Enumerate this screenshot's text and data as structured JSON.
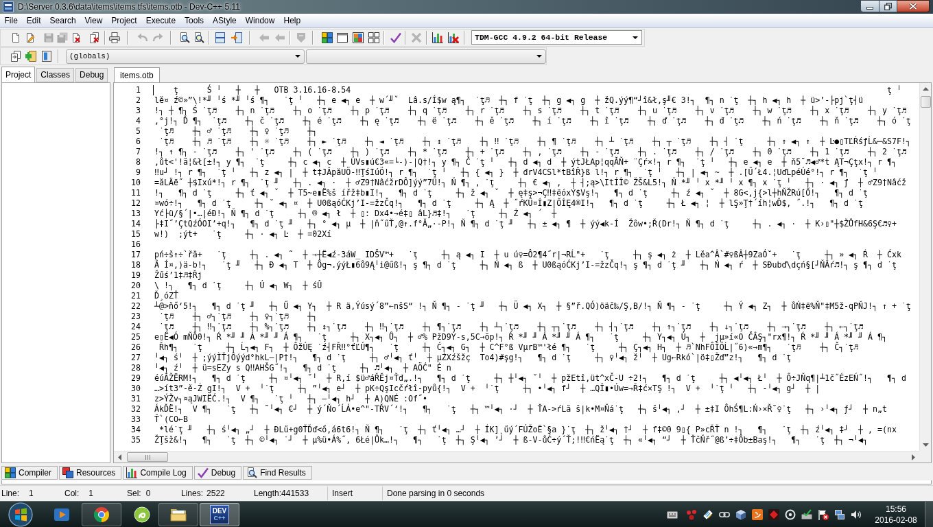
{
  "window": {
    "title": "D:\\Server 0.3.6\\data\\items\\items tfs\\items.otb - Dev-C++ 5.11"
  },
  "menu": [
    "File",
    "Edit",
    "Search",
    "View",
    "Project",
    "Execute",
    "Tools",
    "AStyle",
    "Window",
    "Help"
  ],
  "toolbar": {
    "compiler": "TDM-GCC 4.9.2 64-bit Release",
    "scope": "(globals)"
  },
  "left_panel": {
    "tabs": [
      {
        "label": "Project",
        "selected": true
      },
      {
        "label": "Classes",
        "selected": false
      },
      {
        "label": "Debug",
        "selected": false
      }
    ]
  },
  "editor": {
    "tabs": [
      {
        "label": "items.otb",
        "selected": true
      }
    ],
    "lines": [
      {
        "number": "1",
        "text": "    ţ      Ś ╵   ┼   ┼   OTB 3.16.16-8.54                                                                                                                ţ ╵"
      },
      {
        "number": "2",
        "text": "lĕ¤ ź©»”\\!*╜ ╵ś *╜ ╵ś ¶┐   ˙ţ ╵   ┼┐ e ◀┐ e  ┼ w´╜ˇ  Lâ.s/Í$w ą¶┐  ˙ţ♬  ┼┐ f ˙ţ  ┼┐ g ◀┐ g  ┼ žQ.ýý¶“┘î&ł,ş╜€ 3!┐  ¶┐ n ˙ţ  ┼┐ h ◀┐ h  ┼ ü>’-├pj`ţ┤ü"
      },
      {
        "number": "3",
        "text": "!┐ ┼ ¶┐ Ś ˙ţ♬    ┼┐ n ˙ţ♬    ┼┐ o ˙ţ♬    ┼┐ p ˙ţ♬    ┼┐ q ˙ţ♬    ┼┐ r ˙ţ♬    ┼┐ s ˙ţ♬    ┼┐ t ˙ţ♬    ┼┐ u ˙ţ♬    ┼┐ v ˙ţ♬    ┼┐ w ˙ţ♬    ┼┐ x ˙ţ♬    ┼┐ y ˙ţ♬"
      },
      {
        "number": "4",
        "text": ",°j!┐ Ď ¶┐  ˙ţ♬    ┼┐ č ˙ţ♬    ┼┐ é ˙ţ♬    ┼┐ ę ˙ţ♬    ┼┐ ë ˙ţ♬    ┼┐ ě ˙ţ♬    ┼┐ í ˙ţ♬    ┼┐ î ˙ţ♬    ┼┐ ď ˙ţ♬    ┼┐ đ ˙ţ♬    ┼┐ ń ˙ţ♬    ┼┐ ň ˙ţ♬    ┼┐ ó ˙ţ"
      },
      {
        "number": "5",
        "text": " ˙ţ♬    ┼┐ ♂ ˙ţ♬    ┼┐ ♀ ˙ţ♬    ┼┐"
      },
      {
        "number": "6",
        "text": " ˙ţ♬    ┼┐ ♬ ˙ţ♬    ┼┐ ☼ ˙ţ♬    ┼┐ ► ˙ţ♬    ┼┐ ◄ ˙ţ♬    ┼┐ ↕ ˙ţ♬    ┼┐ ‼ ˙ţ♬    ┼┐ ¶ ˙ţ♬    ┼┐ ┴ ˙ţ♬    ┼┐ ┬ ˙ţ♬    ┼┐ ┤ ˙ţ     ┼┐ ↑ ◀┐ ↑  ┼ Ŀ●▯TĽŔśƒĹ&─&S7F!┐"
      },
      {
        "number": "7",
        "text": "!┐ ↑ ¶┐ - ˙ţ♬    ┼┐ ' ˙ţ♬    ┼┐ ( ˙ţ♬    ┼┐ ) ˙ţ♬    ┼┐ * ˙ţ♬    ┼┐ + ˙ţ♬    ┼┐ , ˙ţ♬    ┼┐ - ˙ţ♬    ┼┐ . ˙ţ♬    ┼┐ / ˙ţ♬    ┼┐ 0 ˙ţ♬    ┼┐ 1 ˙ţ♬    ┼┐ 2 ˙ţ♬"
      },
      {
        "number": "8",
        "text": ",ůt<'!ă¦&ł[±!┐ y ¶┐  ˙ţ     ┼┐ c ◀┐ c  ┼ ÚVs▮ú€3«=└-)-|Q†!┐ y ¶┐ Č ˙ţ ╵   ┼┐ d ◀┐ d  ┼ ýtJŁAp¦qqĂŇ+ ¨Çŕ×!┐ r ¶┐  ˙ţ ╵   ┼┐ e ◀┐ e  ┼ ň5˘♬◀♂*t ĄT¬Çţx!┐ r ¶┐"
      },
      {
        "number": "9",
        "text": "‼u┘ !┐ r ¶┐  ˙ţ ╵   ┼┐ z ◀┐ |  ┼ t‡JÂpăUÖ-‼ŢśIúÖ!┐ r ¶┐  ˙ţ ╵   ┼┐ { ◀┐ }  ┼ đrV4CSl*tBîŘ}ß l!┐ r ¶┐  ˙ţ ╵   ┼┐ | ◀┐ ~  ┼ .[Ű´Ł4.¦UďLpéÚé°!┐ r ¶┐  ˙ţ ╵"
      },
      {
        "number": "10",
        "text": "=ăLÄë˝ ┼$Ixú*!┐ r ¶┐  ˙ţ ╜   ┼┐ . ◀┐ ·  ┼ ♂Z9†NâćžrDÔ]ýý”7Ű!┐ Ň ¶┐ , ˙ţ     ┼┐ € ◀┐ ,  ┼ ┤;ą>\\ItÍÎ© ŽŠ&L5!┐ Ň *╜ ╵ x *╜ ╵ x ¶┐ x ˙ţ ╵   ┼┐ · ◀┐ ƒ  ┼ ♂Z9†Nâćž"
      },
      {
        "number": "11",
        "text": "!┐   ¶┐ d ˙ţ     ┼┐ ť ◀┐ ˇ  ┼ T5~e▮Ë%š ířž‡b▮I!┐   ¶┐ d ˙ţ     ┼┐ ž ◀┐ ˇ  ┼ ę‡ş>¬Ç‼‡ëóxÝ$Vş!┐   ¶┐ d ˙ţ     ┼┐ ź ◀┐ ˇ  ┼ 8G<,j{>l┼hŇŽRú[Ő!┐   ¶┐ d ˙ţ"
      },
      {
        "number": "12",
        "text": "¤wó÷!┐   ¶┐ d ˙ţ     ┼┐ ˘ ◀┐ ¤  ┼ U0ßąóĆKj’I-=žzČq!┐   ¶┐ d ˙ţ     ┼┐ Ą  ┼ ˝ŕKŰ¤Í▮Z|ŐÍĘ4®I!┐   ¶┐ d ˙ţ     ┼┐ Ł ◀┐ ¦  ┼ lŞ»Ţ†´íh¦wĎ$, ˝.!┐   ¶┐ d ˙ţ"
      },
      {
        "number": "13",
        "text": "Yć├ü/§´|•…|éĐ!┐ Ň ¶┐ d ˙ţ     ┼┐ ® ◀┐ ł  ┼ ▯: Dx4•→é‡▯ âL}♬‡!┐   ˙ţ     ┼┐ Ż ◀┐ ´  ┼"
      },
      {
        "number": "14",
        "text": "├‡I˝’ÇtQźÓOI’+q!┐   ¶┐ d ˙ţ ╜   ┼┐ ° ◀┐ µ  ┼ |ň˝űŤ,@↑.f°Ă„·-P!┐ Ň ¶┐ d ˙ţ ╜   ┼┐ ± ◀┐ ¶  ┼ ýý◀k-Í  Žôw•;Ř(Dr!┐ Ň ¶┐ d ˙ţ     ┼┐ . ◀┐ ·  ┼ K›▯\"┼$ŽŮfH&6Ş€♬♀+"
      },
      {
        "number": "15",
        "text": "w!)  ;ýt+   ˙ţ     ┼┐ · ◀┐ Ŀ  ┼ =02Xí"
      },
      {
        "number": "16"
      },
      {
        "number": "17",
        "text": "pń÷š↑÷`řă+   ˙ţ     ┼┐ . ◀┐ ˜  ┼ →┼Ë◀ź-3áW_ IDŠV™+   ˙ţ     ┼┐ ą ◀┐ I  ┼ u ú♀=Ô2¶4˝r|¬RĹ\"+   ˙ţ     ┼┐ ş ◀┐ ż  ┼ Lĕa^Â`#♀ßÂ┼9ZaÓ˘+   ˙ţ     ┼┐ » ◀┐ Ŕ  ┼ Ćxk"
      },
      {
        "number": "18",
        "text": "Â Í¤,)ä-b!┐   ˙ţ ╜   ┼┐ Đ ◀┐ T  ┼ Ôg¬.ýýŁ▮6ů9Ą╵i@űß!┐ ş ¶┐ d ˙ţ     ┼┐ Ń ◀┐ ß  ┼ U0ßąóĆKj’I-=žzČq!┐ ş ¶┐ d ˙ţ ╜   ┼┐ Ń ◀┐ ŕ  ┼ SĐubď\\dçń§[┘ŇÂŕ♬!┐ ş ¶┐ d ˙ţ"
      },
      {
        "number": "19",
        "text": "Žűś’1‡♬‡Řj"
      },
      {
        "number": "20",
        "text": "\\ !┐   ¶┐ d ˙ţ     ┼┐ Ú ◀┐ W┐  ┼ śÛ"
      },
      {
        "number": "21",
        "text": "Ď¸óZŤ"
      },
      {
        "number": "22",
        "text": "┴@>ňő‘5!┐   ¶┐ d ˙ţ ╜   ┼┐ Ű ◀┐ Y┐  ┼ R ä,Ýúsý´8”←nšS“ !┐ Ň ¶┐ - ˙ţ ╜   ┼┐ Ü ◀┐ X┐  ┼ §”ř.QÓ)öäč‰/Ş,B/!┐ Ň ¶┐ - ˙ţ     ┼┐ Ý ◀┐ Z┐  ┼ ůŃ‡ë%Ň\"‡M5ž-qPŇJ!┐ ↑ + ˙ţ"
      },
      {
        "number": "23",
        "text": " ˙ţ♬    ┼┐ ♂┐˙ţ♬    ┼┐ ♀┐˙ţ♬    ┼┐"
      },
      {
        "number": "24",
        "text": " ˙ţ♬    ┼┐ ‼┐˙ţ♬    ┼┐ %┐˙ţ♬    ┼┐ ↕┐˙ţ♬    ┼┐ ‼┐˙ţ♬    ┼┐ ¶┐˙ţ♬    ┼┐ ┴┐˙ţ♬    ┼┐ ┬┐˙ţ♬    ┼┐ ┤┐˙ţ♬    ┼┐ ↑┐˙ţ♬    ┼┐ ↓┐˙ţ♬    ┼┐ →┐˙ţ♬    ┼┐ ←┐˙ţ♬"
      },
      {
        "number": "25",
        "text": "e▯Ë◀Ó mŇÔ0!┐ Ŕ *╜ ╜ Á *╜ ╜ Á ¶┐   ˙ţ     ┼┐ X┐◀┐ Ů┐  ┼ ♂% PžD9Ý-s,5C→ŏp!┐ Ŕ *╜ ╜ Á *╜ ╜ Á ¶┐   ˙ţ     ┼┐ Y┐◀┐ Ú┐  ┼  jµ»í«O ČÂŞ┐\"rx¶!┐ Ŕ *╜ ╜ Á *╜ ╜ Á ¶┐"
      },
      {
        "number": "26",
        "text": " Řh¶┐   ˙ţ     ┼┐ Ĺ┐◀┐ F┐  ┼ ÔžÚĘ ˙ź┤FŘ‼°ťĽÚ¶┐   ˙ţ     ┼┐ Ć┐◀┐ G┐  ┼ C^F°ß VµrB™'łé ¶┐   ˙ţ     ┼┐ Ç┐◀┐ H┐  ┼ ♬`NhFÔÎÖĹ|˝6)«→m¶┐   ˙ţ♬    ┼┐ Č┐˙ţ♬"
      },
      {
        "number": "27",
        "text": "╵◀┐ ś╵  ┼ ;ýýÌŤjÔýýd°hkL—|P†!┐   ¶┐ d ˙ţ     ┼┐ ♂╵◀┐ ť╵  ┼ µŻXźšžç  To4)#şg!┐   ¶┐ d ˙ţ     ┼┐ ♀╵◀┐ ž╵  ┼ Ug←Rkó`|ö‡▯Žď”z!┐   ¶┐ d ˙ţ"
      },
      {
        "number": "28",
        "text": "╵◀┐ ź╵  ┼ ü=sEZy s Q‼AHŠG˝!┐   ¶┐ d ˙ţ     ┼┐ ♬╵◀┐  ┼ AÖĆ\" É n"
      },
      {
        "number": "29",
        "text": "éúĂŽËRM!┐   ¶┐ d ˙ţ     ┼┐ ¤╵◀┐ ˘╵  ┼ R,í $ü♂áŘĔj¤Ťđ„.!┐   ¶┐ d ˙ţ     ┼┐ ┼╵◀┐ ˘╵  ┼ pžEtî,üt^xČ-U ÷2!┐   ¶┐ d ˙ţ     ┼┐ ◀╵◀┐ Ł╵  ┼ Ő÷JŇq¶|┴1č˝ÉzEŃ˝!┐   ¶┐ d"
      },
      {
        "number": "30",
        "text": "…>ít3”-ě-Ź gI!┐  V +  ╵˙ţ     ┼┐ ”╵◀┐ e┘  ┼ pK÷QşIcčŕłî-pyů{!┐  V +  ╵˙ţ     ┼┐ •╵◀┐ f┘  ┼ …QÎ▮•Úw=→Ř‡ć×TŞ !┐  V +  ╵˙ţ ╵   ┼┐ -╵◀┐ g┘  ┼ |"
      },
      {
        "number": "31",
        "text": "z>ÝŽv┐¤ąJWIËĆ.!┐  V ¶┐   ˙ţ ╵   ┼┐ —╵◀┐ h┘  ┼ A)QNÉ :Of˝•"
      },
      {
        "number": "32",
        "text": "ÁkĎË!┐  V ¶┐   ˙ţ   ┼┐ ˜╵◀┐ €┘  ┼ ý´Ňo´ĹÁ•e^\"-TŘV´‘!┐   ¶┐   ˙ţ   ┼┐ ™╵◀┐ ·┘  ┼ ŤA->ŕLă š|k•M¤Ňá˙ţ   ┼┐ š╵◀┐ ,┘  ┼ ±‡I ÔhŚ¶L:Ń›×Ř˘♀˙ţ   ┼┐ ›╵◀┐ ƒ┘  ┼ n„t"
      },
      {
        "number": "33",
        "text": "Ť`(CO←B"
      },
      {
        "number": "34",
        "text": " *lé˙ţ ╜   ┼┐ ś╵◀┐ „┘  ┼ ĐLű+g0ŤĎď<ő,á6t6!┐ Ň ¶┐   ˙ţ  ┼┐ ť╵◀┐ …┘  ┼ ÍK]˛űý´FÚŽoË`§a }˙ţ  ┼┐ ž╵◀┐ †┘  ┼ f‡©0 9▯{ P»cŘŤ n !┐   ¶┐   ˙ţ  ┼┐ ź╵◀┐ ‡┘  ┼ , =(nx"
      },
      {
        "number": "35",
        "text": "ŽŢšž&!┐   ¶┐   ˙ţ  ┼┐ ©╵◀┐ ˙┘  ┼ µ%ü•Á%˝, 6Łé|Ůk…!┐   ¶┐   ˙ţ  ┼┐ Ş╵◀┐ ’┘  ┼ ß-V-ůĆ÷ý´Ť;!‼€ńËą˙ţ  ┼┐ «╵◀┐ “┘  ┼ ŤčŇř˝@ß’÷‡Ôb±Baş!┐   ¶┐   ˙ţ  ┼┐ ¬╵◀┐"
      }
    ]
  },
  "bottom_tabs": [
    {
      "label": "Compiler",
      "selected": false
    },
    {
      "label": "Resources",
      "selected": false
    },
    {
      "label": "Compile Log",
      "selected": false
    },
    {
      "label": "Debug",
      "selected": false
    },
    {
      "label": "Find Results",
      "selected": false
    }
  ],
  "status_bar": {
    "line": {
      "label": "Line:",
      "value": "1"
    },
    "col": {
      "label": "Col:",
      "value": "1"
    },
    "sel": {
      "label": "Sel:",
      "value": "0"
    },
    "lines": {
      "label": "Lines:",
      "value": "2522"
    },
    "length": "Length:441533",
    "mode": "Insert",
    "message": "Done parsing in 0 seconds"
  },
  "taskbar": {
    "logo_text": [
      "DEV",
      "C++"
    ],
    "time": "15:56",
    "date": "2016-02-08"
  }
}
